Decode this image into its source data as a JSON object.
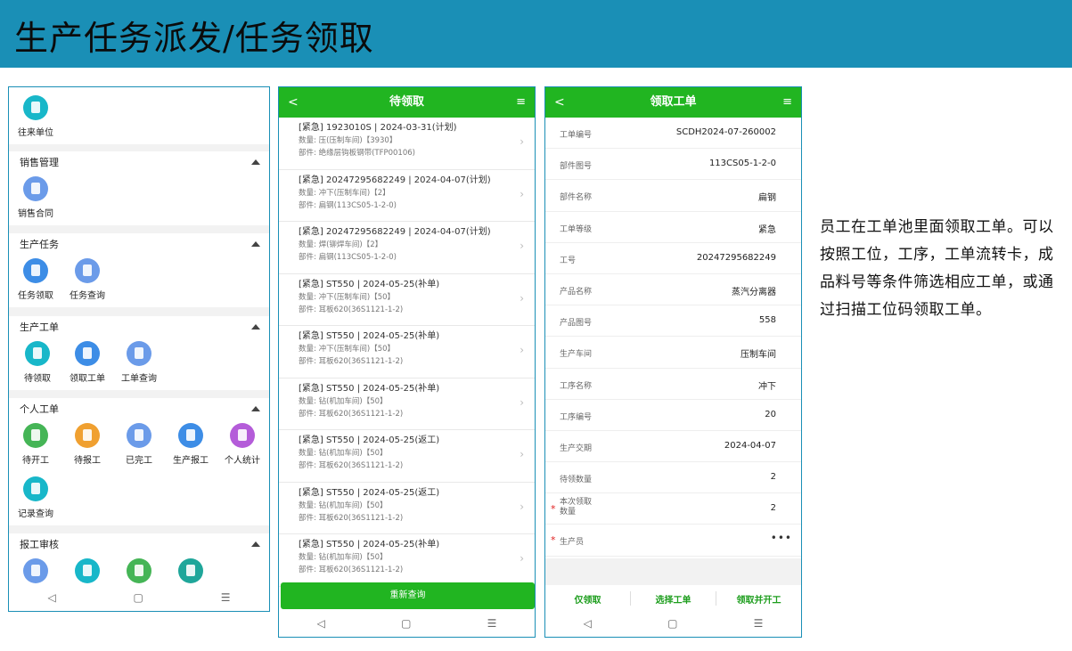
{
  "banner": {
    "title": "生产任务派发/任务领取"
  },
  "panel1": {
    "top_item": {
      "label": "往来单位",
      "icon": "contacts-icon",
      "color": "#18b7c9"
    },
    "sections": [
      {
        "title": "销售管理",
        "items": [
          {
            "label": "销售合同",
            "icon": "cart-icon"
          }
        ]
      },
      {
        "title": "生产任务",
        "items": [
          {
            "label": "任务领取",
            "icon": "clipboard-icon"
          },
          {
            "label": "任务查询",
            "icon": "calendar-icon"
          }
        ]
      },
      {
        "title": "生产工单",
        "items": [
          {
            "label": "待领取",
            "icon": "doc-icon"
          },
          {
            "label": "领取工单",
            "icon": "clipboard-icon"
          },
          {
            "label": "工单查询",
            "icon": "calendar-icon"
          }
        ]
      },
      {
        "title": "个人工单",
        "items": [
          {
            "label": "待开工",
            "icon": "doc-icon"
          },
          {
            "label": "待报工",
            "icon": "calendar-icon"
          },
          {
            "label": "已完工",
            "icon": "calendar-icon"
          },
          {
            "label": "生产报工",
            "icon": "clipboard-icon"
          },
          {
            "label": "个人统计",
            "icon": "stats-icon"
          },
          {
            "label": "记录查询",
            "icon": "doc-icon"
          }
        ]
      },
      {
        "title": "报工审核",
        "items": [
          {
            "label": "",
            "icon": "font-icon"
          },
          {
            "label": "",
            "icon": "doc-icon"
          },
          {
            "label": "",
            "icon": "doc-icon"
          },
          {
            "label": "",
            "icon": "list-icon"
          }
        ]
      }
    ],
    "nav": {
      "back": "◁",
      "home": "▢",
      "menu": "☰"
    }
  },
  "panel2": {
    "header": {
      "title": "待领取",
      "back": "<",
      "menu": "≡"
    },
    "items": [
      {
        "line1": "[紧急] 1923010S | 2024-03-31(计划)",
        "line2": "数量: 压(压制车间)【3930】",
        "line3": "部件: 绝缘层钩板钢带(TFP00106)"
      },
      {
        "line1": "[紧急] 20247295682249 | 2024-04-07(计划)",
        "line2": "数量: 冲下(压制车间)【2】",
        "line3": "部件: 扁钢(113CS05-1-2-0)"
      },
      {
        "line1": "[紧急] 20247295682249 | 2024-04-07(计划)",
        "line2": "数量: 焊(铆焊车间)【2】",
        "line3": "部件: 扁钢(113CS05-1-2-0)"
      },
      {
        "line1": "[紧急] ST550 | 2024-05-25(补单)",
        "line2": "数量: 冲下(压制车间)【50】",
        "line3": "部件: 耳板620(36S1121-1-2)"
      },
      {
        "line1": "[紧急] ST550 | 2024-05-25(补单)",
        "line2": "数量: 冲下(压制车间)【50】",
        "line3": "部件: 耳板620(36S1121-1-2)"
      },
      {
        "line1": "[紧急] ST550 | 2024-05-25(补单)",
        "line2": "数量: 钻(机加车间)【50】",
        "line3": "部件: 耳板620(36S1121-1-2)"
      },
      {
        "line1": "[紧急] ST550 | 2024-05-25(返工)",
        "line2": "数量: 钻(机加车间)【50】",
        "line3": "部件: 耳板620(36S1121-1-2)"
      },
      {
        "line1": "[紧急] ST550 | 2024-05-25(返工)",
        "line2": "数量: 钻(机加车间)【50】",
        "line3": "部件: 耳板620(36S1121-1-2)"
      },
      {
        "line1": "[紧急] ST550 | 2024-05-25(补单)",
        "line2": "数量: 钻(机加车间)【50】",
        "line3": "部件: 耳板620(36S1121-1-2)"
      }
    ],
    "button": "重新查询",
    "nav": {
      "back": "◁",
      "home": "▢",
      "menu": "☰"
    }
  },
  "panel3": {
    "header": {
      "title": "领取工单",
      "back": "<",
      "menu": "≡"
    },
    "fields": [
      {
        "label": "工单编号",
        "value": "SCDH2024-07-260002"
      },
      {
        "label": "部件图号",
        "value": "113CS05-1-2-0"
      },
      {
        "label": "部件名称",
        "value": "扁钢"
      },
      {
        "label": "工单等级",
        "value": "紧急"
      },
      {
        "label": "工号",
        "value": "20247295682249"
      },
      {
        "label": "产品名称",
        "value": "蒸汽分离器"
      },
      {
        "label": "产品图号",
        "value": "558"
      },
      {
        "label": "生产车间",
        "value": "压制车间"
      },
      {
        "label": "工序名称",
        "value": "冲下"
      },
      {
        "label": "工序编号",
        "value": "20"
      },
      {
        "label": "生产交期",
        "value": "2024-04-07"
      },
      {
        "label": "待领数量",
        "value": "2"
      }
    ],
    "required_fields": [
      {
        "label_line1": "本次领取",
        "label_line2": "数量",
        "value": "2",
        "star": "*"
      },
      {
        "label": "生产员",
        "value": "•••",
        "star": "*"
      }
    ],
    "actions": [
      "仅领取",
      "选择工单",
      "领取并开工"
    ],
    "nav": {
      "back": "◁",
      "home": "▢",
      "menu": "☰"
    }
  },
  "description": "员工在工单池里面领取工单。可以按照工位，工序，工单流转卡，成品料号等条件筛选相应工单，或通过扫描工位码领取工单。",
  "colors": {
    "banner": "#1a8fb6",
    "green": "#21b521",
    "required": "#e02020"
  }
}
